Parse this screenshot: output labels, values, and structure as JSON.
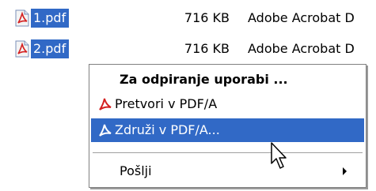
{
  "files": [
    {
      "name": "1.pdf",
      "size": "716 KB",
      "type": "Adobe Acrobat D",
      "icon": "pdf-file-icon"
    },
    {
      "name": "2.pdf",
      "size": "716 KB",
      "type": "Adobe Acrobat D",
      "icon": "pdf-file-icon"
    }
  ],
  "context_menu": {
    "open_with": "Za odpiranje uporabi ...",
    "convert": "Pretvori v PDF/A",
    "merge": "Združi v PDF/A...",
    "send_to": "Pošlji"
  },
  "colors": {
    "selection": "#3169c6"
  }
}
